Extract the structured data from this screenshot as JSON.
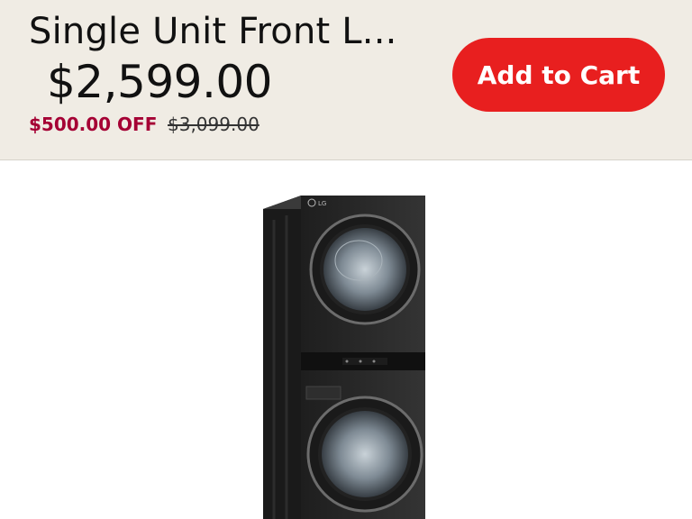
{
  "product": {
    "name": "Single Unit Front L...",
    "price": "$2,599.00",
    "discount": "$500.00 OFF",
    "original_price": "$3,099.00",
    "image_alt": "LG WashTower front load washer and dryer in black steel",
    "brand_badge": "LG"
  },
  "actions": {
    "add_to_cart_label": "Add to Cart"
  },
  "colors": {
    "bar_background": "#f0ece4",
    "cta_red": "#e81f1f",
    "discount_red": "#a50034",
    "appliance_body": "#2b2b2b"
  }
}
